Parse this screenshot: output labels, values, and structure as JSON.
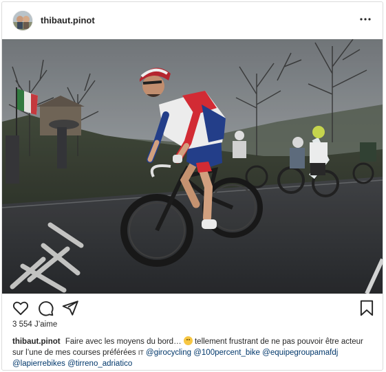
{
  "post": {
    "username": "thibaut.pinot",
    "more_icon": "ellipsis-icon",
    "photo_alt": "",
    "actions": {
      "like_icon": "heart-icon",
      "comment_icon": "comment-icon",
      "share_icon": "paper-plane-icon",
      "save_icon": "bookmark-icon"
    },
    "likes_count": "3 554",
    "likes_label": "J’aime",
    "caption": {
      "user": "thibaut.pinot",
      "text_1": "Faire avec les moyens du bord…",
      "emoji": "disappointed-face-emoji",
      "text_2": " tellement frustrant de ne pas pouvoir être acteur sur l’une de mes courses préférées ",
      "flag": "IT",
      "mentions": [
        "@girocycling",
        "@100percent_bike",
        "@equipegroupamafdj",
        "@lapierrebikes",
        "@tirreno_adriatico"
      ]
    }
  },
  "colors": {
    "border": "#dbdbdb",
    "text": "#262626",
    "mention": "#00376b"
  }
}
